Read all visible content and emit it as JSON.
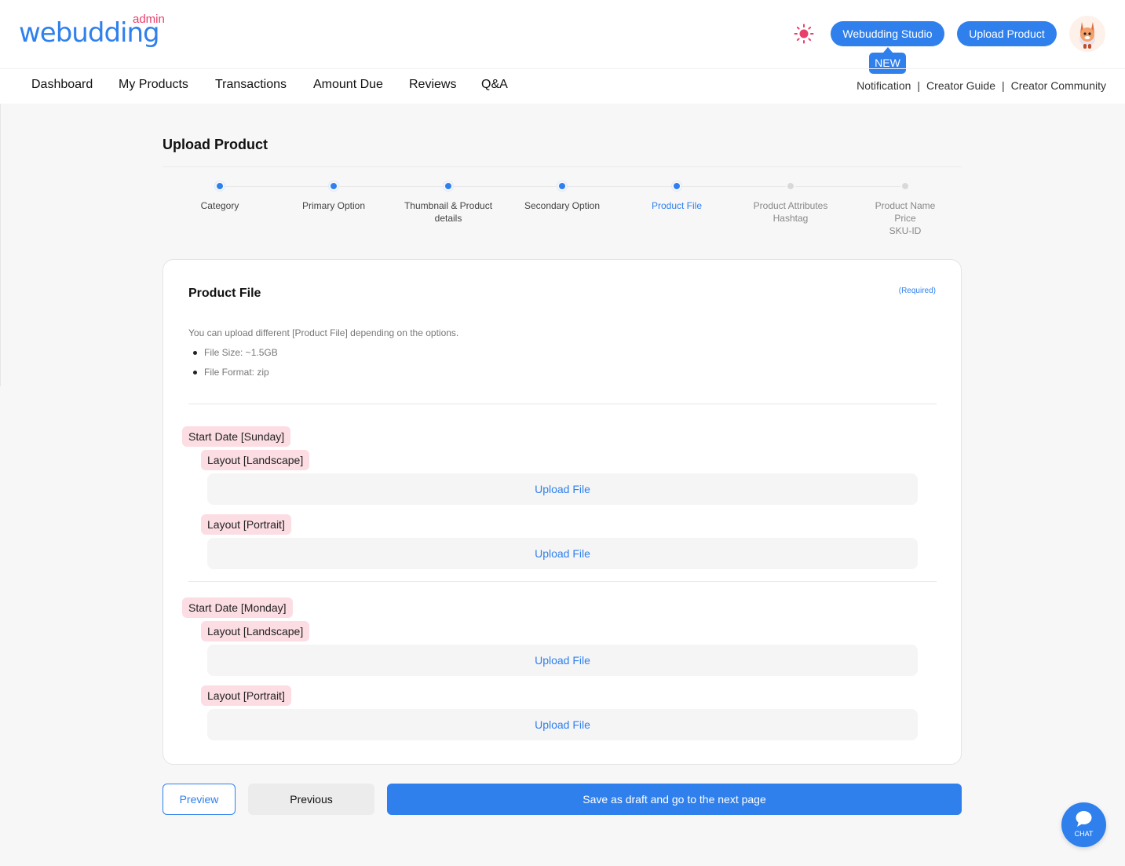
{
  "header": {
    "logo_main": "webudding",
    "logo_admin": "admin",
    "theme_icon": "sun-icon",
    "studio_button": "Webudding Studio",
    "new_badge": "NEW",
    "upload_button": "Upload Product",
    "avatar_icon": "avatar-icon"
  },
  "nav": {
    "items": [
      "Dashboard",
      "My Products",
      "Transactions",
      "Amount Due",
      "Reviews",
      "Q&A"
    ],
    "links": [
      "Notification",
      "Creator Guide",
      "Creator Community"
    ],
    "separator": "|"
  },
  "page": {
    "title": "Upload Product"
  },
  "steps": [
    {
      "label": "Category",
      "state": "done"
    },
    {
      "label": "Primary Option",
      "state": "done"
    },
    {
      "label": "Thumbnail & Product\ndetails",
      "state": "done"
    },
    {
      "label": "Secondary Option",
      "state": "done"
    },
    {
      "label": "Product File",
      "state": "current"
    },
    {
      "label": "Product Attributes\nHashtag",
      "state": "todo"
    },
    {
      "label": "Product Name\nPrice\nSKU-ID",
      "state": "todo"
    }
  ],
  "card": {
    "title": "Product File",
    "required": "(Required)",
    "description": "You can upload different [Product File] depending on the options.",
    "bullets": [
      "File Size: ~1.5GB",
      "File Format: zip"
    ],
    "groups": [
      {
        "label": "Start Date [Sunday]",
        "layouts": [
          {
            "label": "Layout [Landscape]",
            "upload": "Upload File"
          },
          {
            "label": "Layout [Portrait]",
            "upload": "Upload File"
          }
        ]
      },
      {
        "label": "Start Date [Monday]",
        "layouts": [
          {
            "label": "Layout [Landscape]",
            "upload": "Upload File"
          },
          {
            "label": "Layout [Portrait]",
            "upload": "Upload File"
          }
        ]
      }
    ]
  },
  "footer": {
    "preview": "Preview",
    "previous": "Previous",
    "next": "Save as draft and go to the next page"
  },
  "chat": {
    "label": "CHAT",
    "icon": "chat-bubble-icon"
  },
  "colors": {
    "primary": "#2f80ed",
    "tag_bg": "#fbdde3",
    "logo_admin": "#e83e6a",
    "sun": "#e83e6a"
  }
}
